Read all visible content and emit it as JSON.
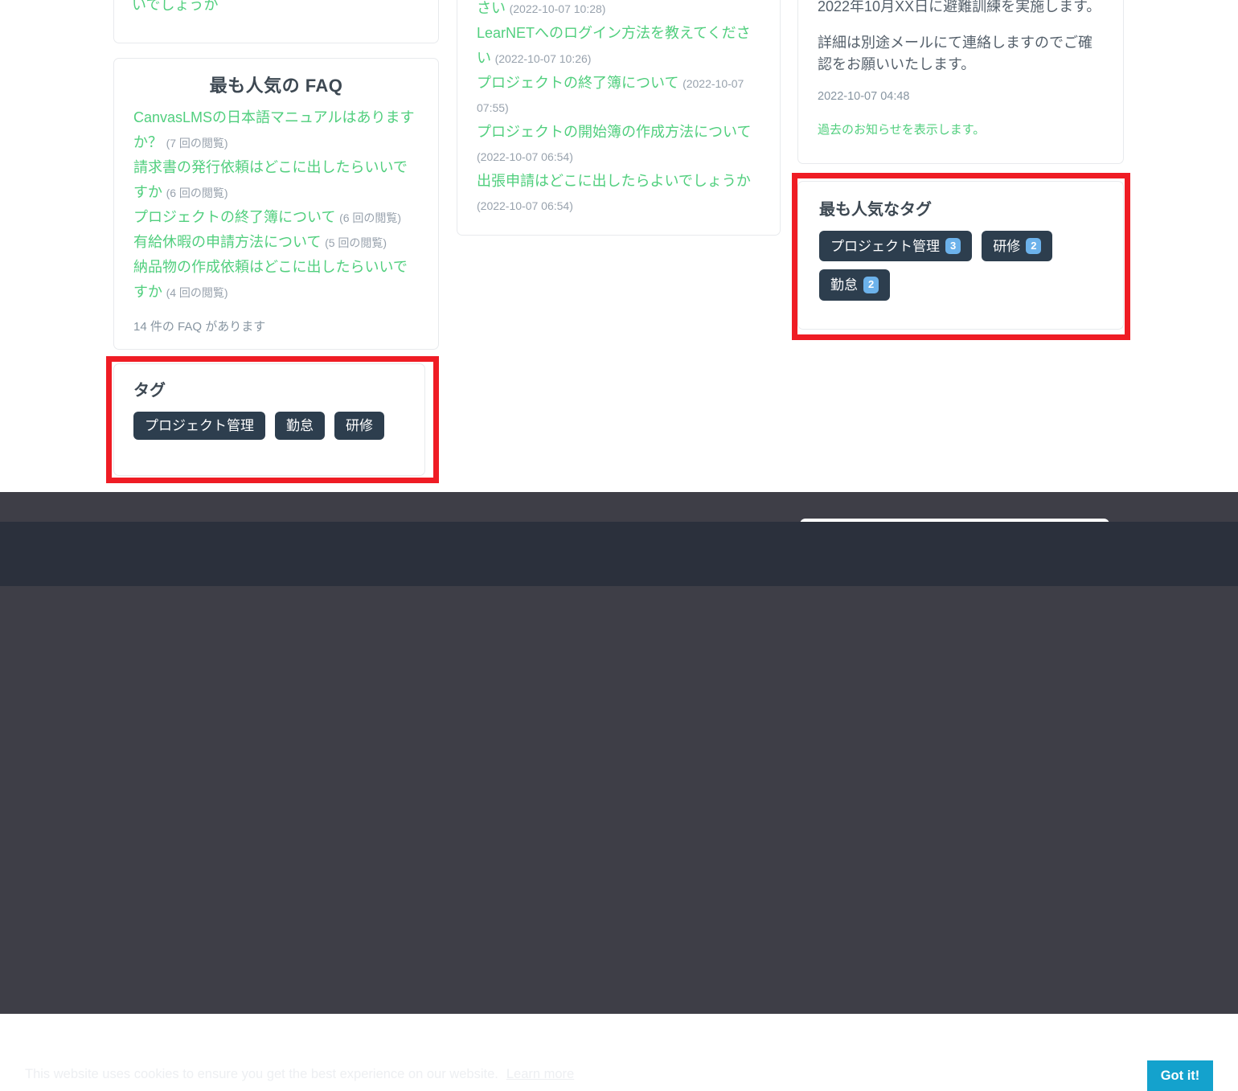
{
  "left_column": {
    "cut_card": {
      "visible_text": "いでしょうか"
    },
    "popular_faq_card": {
      "title": "最も人気の FAQ",
      "items": [
        {
          "label": "CanvasLMSの日本語マニュアルはありますか？",
          "meta": "(7 回の閲覧)"
        },
        {
          "label": "請求書の発行依頼はどこに出したらいいですか",
          "meta": "(6 回の閲覧)"
        },
        {
          "label": "プロジェクトの終了簿について",
          "meta": "(6 回の閲覧)"
        },
        {
          "label": "有給休暇の申請方法について",
          "meta": "(5 回の閲覧)"
        },
        {
          "label": "納品物の作成依頼はどこに出したらいいですか",
          "meta": "(4 回の閲覧)"
        }
      ],
      "count_note": "14 件の FAQ があります"
    },
    "tags_card": {
      "title": "タグ",
      "tags": [
        {
          "label": "プロジェクト管理"
        },
        {
          "label": "勤怠"
        },
        {
          "label": "研修"
        }
      ]
    }
  },
  "middle_column": {
    "recent_faq_card": {
      "items": [
        {
          "label": "さい",
          "meta": "(2022-10-07 10:28)",
          "clipped": true
        },
        {
          "label": "LearNETへのログイン方法を教えてください",
          "meta": "(2022-10-07 10:26)"
        },
        {
          "label": "プロジェクトの終了簿について",
          "meta": "(2022-10-07 07:55)"
        },
        {
          "label": "プロジェクトの開始簿の作成方法について",
          "meta": "(2022-10-07 06:54)"
        },
        {
          "label": "出張申請はどこに出したらよいでしょうか",
          "meta": "(2022-10-07 06:54)"
        }
      ]
    }
  },
  "right_column": {
    "announcement_card": {
      "paragraphs": [
        "2022年10月XX日に避難訓練を実施します。",
        "詳細は別途メールにて連絡しますのでご確認をお願いいたします。"
      ],
      "date": "2022-10-07 04:48",
      "archive_link": "過去のお知らせを表示します。"
    },
    "popular_tags_card": {
      "title": "最も人気なタグ",
      "tags": [
        {
          "label": "プロジェクト管理",
          "count": "3"
        },
        {
          "label": "研修",
          "count": "2"
        },
        {
          "label": "勤怠",
          "count": "2"
        }
      ]
    }
  },
  "cookie_banner": {
    "message": "This website uses cookies to ensure you get the best experience on our website.",
    "learn_more": "Learn more",
    "accept_label": "Got it!"
  },
  "colors": {
    "link_green": "#51cf7e",
    "tag_dark": "#2d3e4e",
    "badge_blue": "#6cb2eb",
    "highlight_red": "#ef1c24",
    "accept_blue": "#14a2cd",
    "footer_dark": "#3e3e47",
    "cookie_dark": "#2b303c"
  }
}
